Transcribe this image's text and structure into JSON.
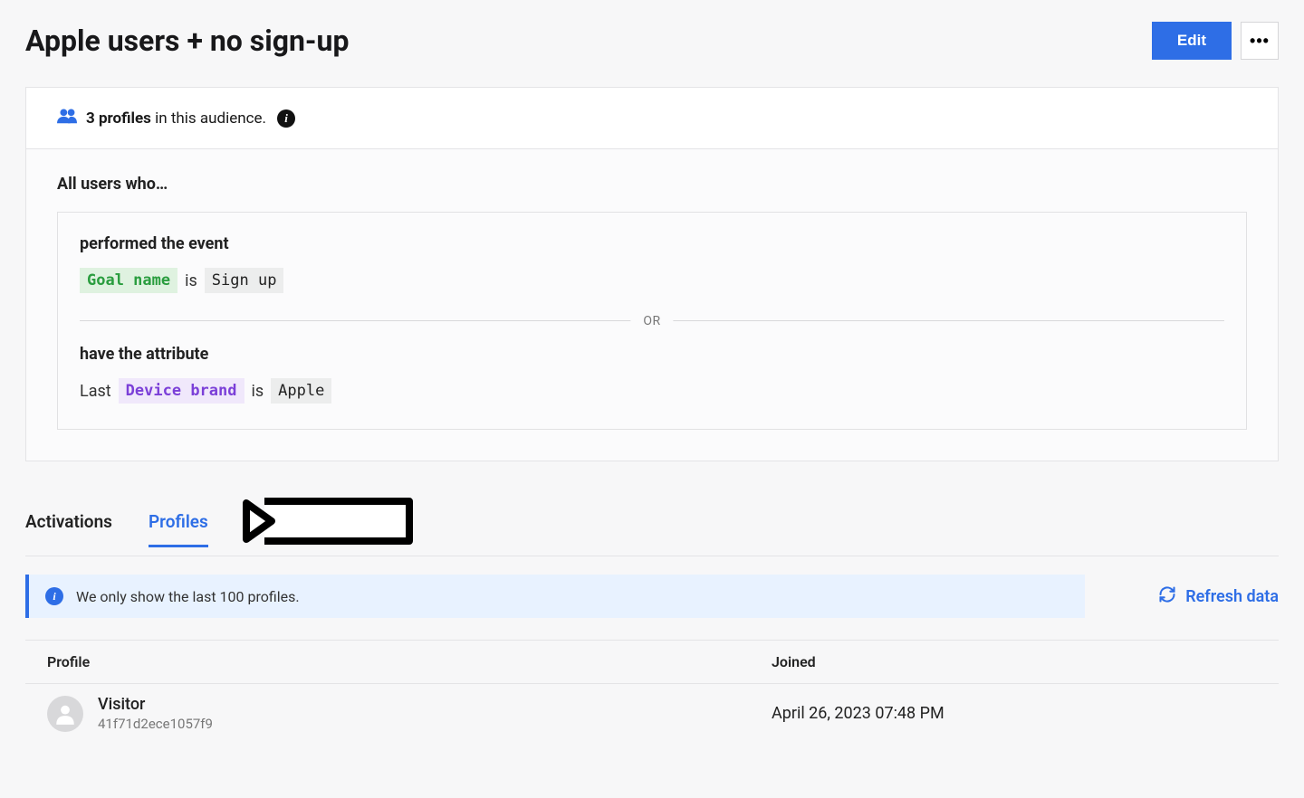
{
  "header": {
    "title": "Apple users + no sign-up",
    "edit_label": "Edit",
    "more_label": "•••"
  },
  "summary": {
    "count_label": "3 profiles",
    "suffix_text": "in this audience."
  },
  "criteria": {
    "heading": "All users who…",
    "block1": {
      "title": "performed the event",
      "chip_label": "Goal name",
      "operator": "is",
      "value": "Sign up"
    },
    "divider": "OR",
    "block2": {
      "title": "have the attribute",
      "prefix": "Last",
      "chip_label": "Device brand",
      "operator": "is",
      "value": "Apple"
    }
  },
  "tabs": {
    "activations": "Activations",
    "profiles": "Profiles"
  },
  "banner": {
    "text": "We only show the last 100 profiles."
  },
  "refresh": {
    "label": "Refresh data"
  },
  "table": {
    "col_profile": "Profile",
    "col_joined": "Joined",
    "row1": {
      "name": "Visitor",
      "id": "41f71d2ece1057f9",
      "joined": "April 26, 2023 07:48 PM"
    }
  }
}
